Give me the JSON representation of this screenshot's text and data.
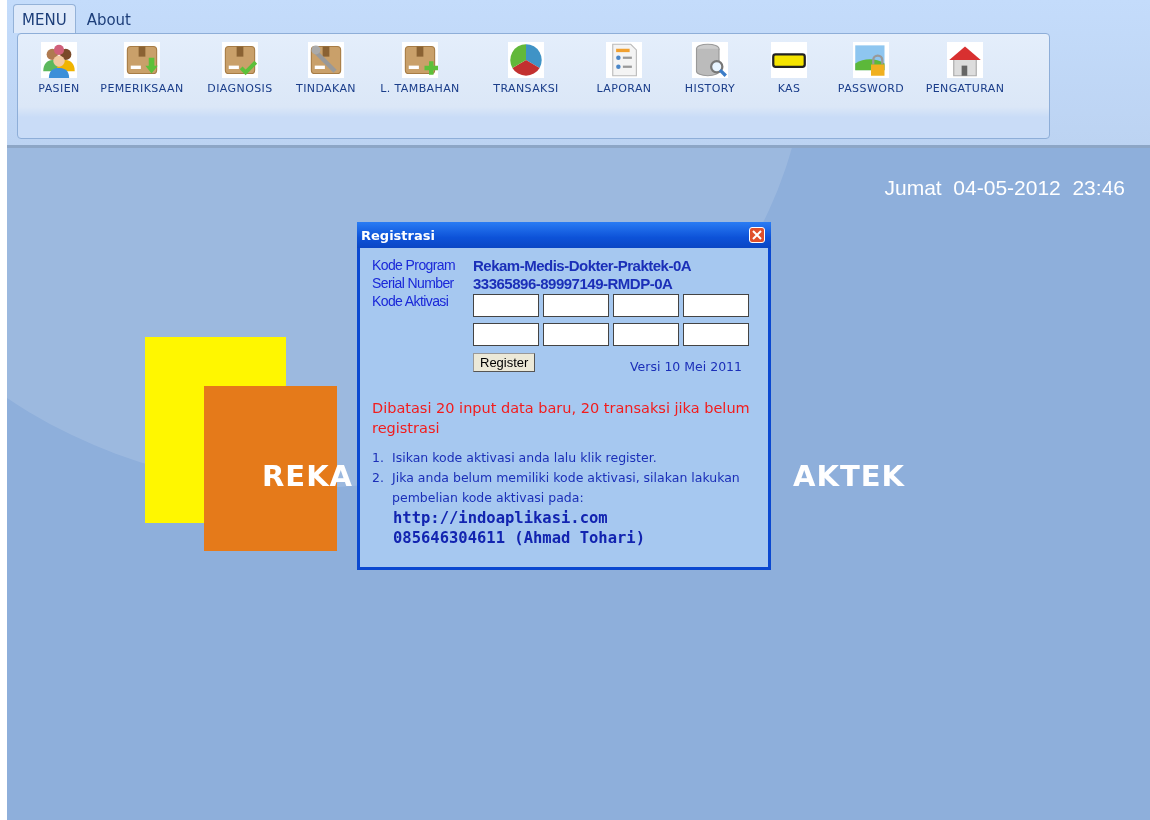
{
  "ribbon": {
    "tabs": [
      {
        "label": "MENU",
        "selected": true
      },
      {
        "label": "About",
        "selected": false
      }
    ],
    "items": [
      {
        "label": "PASIEN",
        "kind": "people"
      },
      {
        "label": "PEMERIKSAAN",
        "kind": "box-down"
      },
      {
        "label": "DIAGNOSIS",
        "kind": "box-check"
      },
      {
        "label": "TINDAKAN",
        "kind": "box-wrench"
      },
      {
        "label": "L. TAMBAHAN",
        "kind": "box-plus"
      },
      {
        "label": "TRANSAKSI",
        "kind": "pie"
      },
      {
        "label": "LAPORAN",
        "kind": "report"
      },
      {
        "label": "HISTORY",
        "kind": "database"
      },
      {
        "label": "KAS",
        "kind": "bar"
      },
      {
        "label": "PASSWORD",
        "kind": "lock"
      },
      {
        "label": "PENGATURAN",
        "kind": "house"
      }
    ]
  },
  "datetime": "Jumat  04-05-2012  23:46",
  "banner": {
    "left": "REKA",
    "right": "AKTEK"
  },
  "dialog": {
    "title": "Registrasi",
    "info": [
      {
        "label": "Kode Program",
        "value": "Rekam-Medis-Dokter-Praktek-0A"
      },
      {
        "label": "Serial Number",
        "value": "33365896-89997149-RMDP-0A"
      }
    ],
    "activation_label": "Kode Aktivasi",
    "activation_fields": [
      {
        "kind": "text"
      },
      {
        "kind": "text"
      },
      {
        "kind": "text"
      },
      {
        "kind": "text"
      },
      {
        "kind": "text"
      },
      {
        "kind": "text"
      },
      {
        "kind": "text"
      },
      {
        "kind": "text"
      }
    ],
    "register_button": "Register",
    "version": "Versi 10 Mei 2011",
    "warning": "Dibatasi 20 input data baru, 20 transaksi jika belum registrasi",
    "steps": [
      {
        "number": "1.",
        "text": "Isikan kode aktivasi anda lalu klik register."
      },
      {
        "number": "2.",
        "text": "Jika anda belum memiliki kode aktivasi, silakan lakukan pembelian kode aktivasi pada:"
      }
    ],
    "website": "http://indoaplikasi.com",
    "contact": "085646304611 (Ahmad Tohari)"
  }
}
